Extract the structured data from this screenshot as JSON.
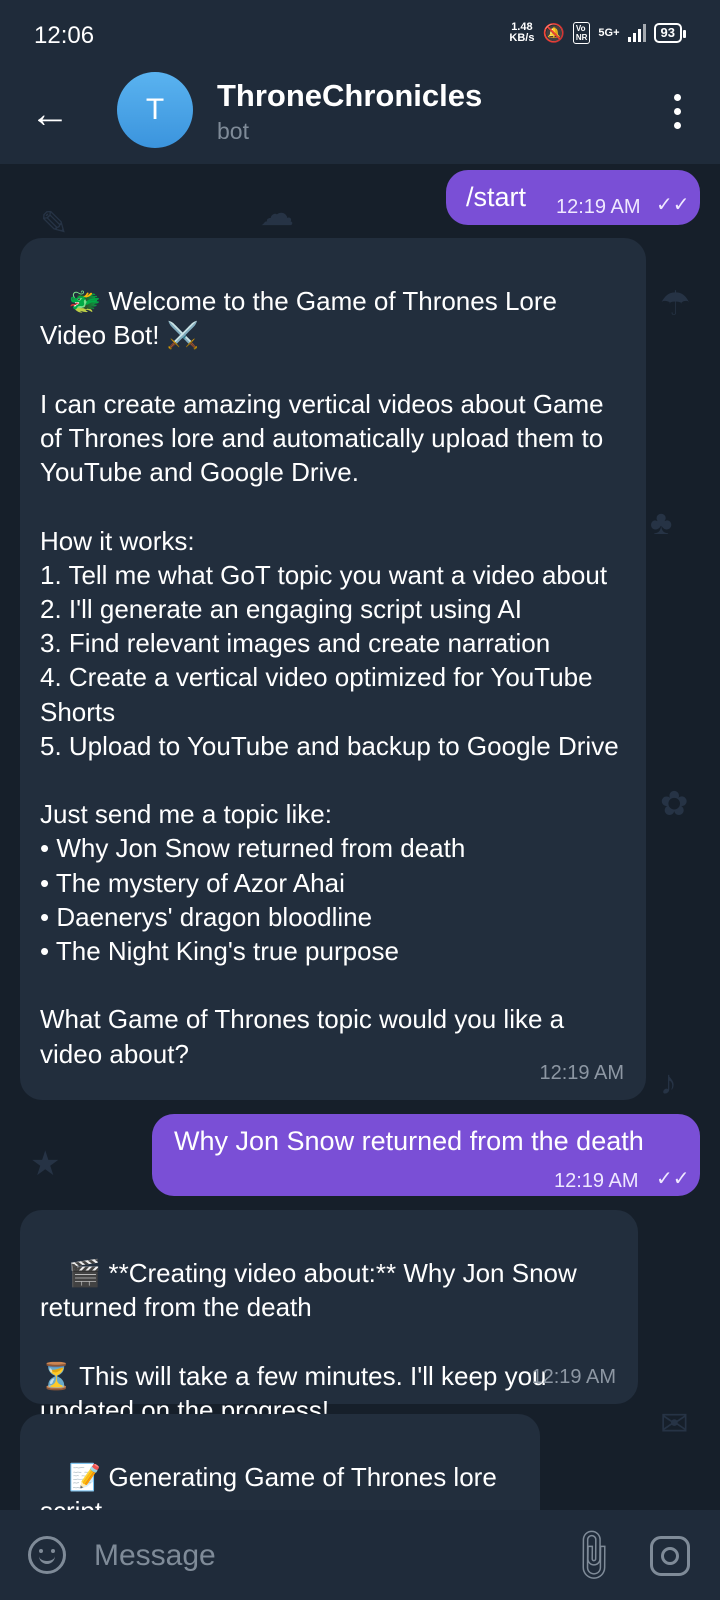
{
  "status_bar": {
    "time": "12:06",
    "net_speed_value": "1.48",
    "net_speed_unit": "KB/s",
    "volte": "Vo\nNR",
    "network": "5G+",
    "battery": "93"
  },
  "header": {
    "avatar_letter": "T",
    "title": "ThroneChronicles",
    "subtitle": "bot"
  },
  "messages": [
    {
      "type": "outgoing",
      "text": "/start",
      "time": "12:19 AM"
    },
    {
      "type": "incoming",
      "text": "🐲 Welcome to the Game of Thrones Lore Video Bot! ⚔️\n\nI can create amazing vertical videos about Game of Thrones lore and automatically upload them to YouTube and Google Drive.\n\nHow it works:\n1. Tell me what GoT topic you want a video about\n2. I'll generate an engaging script using AI\n3. Find relevant images and create narration\n4. Create a vertical video optimized for YouTube Shorts\n5. Upload to YouTube and backup to Google Drive\n\nJust send me a topic like:\n• Why Jon Snow returned from death\n• The mystery of Azor Ahai\n• Daenerys' dragon bloodline\n• The Night King's true purpose\n\nWhat Game of Thrones topic would you like a video about?",
      "time": "12:19 AM"
    },
    {
      "type": "outgoing",
      "text": "Why Jon Snow returned from the death",
      "time": "12:19 AM"
    },
    {
      "type": "incoming",
      "text": "🎬 **Creating video about:** Why Jon Snow returned from the death\n\n⏳ This will take a few minutes. I'll keep you updated on the progress!",
      "time": "12:19 AM"
    },
    {
      "type": "incoming",
      "text": "📝 Generating Game of Thrones lore script...",
      "time": ""
    }
  ],
  "input": {
    "placeholder": "Message"
  },
  "colors": {
    "outgoing_bubble": "#7a4fd6",
    "incoming_bubble": "#222e3d",
    "background": "#161f2a",
    "header": "#1f2b3a",
    "avatar": "#4aa3e8"
  },
  "icons": [
    "back-arrow-icon",
    "more-vert-icon",
    "emoji-icon",
    "attach-icon",
    "camera-icon",
    "double-check-icon"
  ]
}
